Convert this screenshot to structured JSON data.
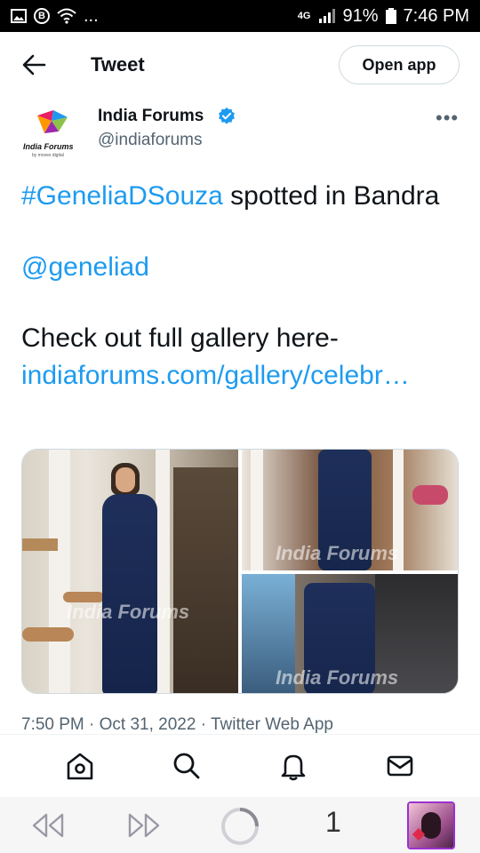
{
  "status_bar": {
    "network": "4G",
    "battery": "91%",
    "time": "7:46 PM",
    "overflow": "...",
    "notification_b": "B"
  },
  "header": {
    "title": "Tweet",
    "open_app_label": "Open app"
  },
  "author": {
    "name": "India Forums",
    "handle": "@indiaforums",
    "logo_text": "India Forums",
    "logo_subtext": "by moves digital",
    "more_label": "•••"
  },
  "tweet": {
    "hashtag": "#GeneliaDSouza",
    "line1_rest": " spotted in Bandra",
    "mention": "@geneliad",
    "line3": "Check out full gallery here-",
    "url": "indiaforums.com/gallery/celebr…",
    "timestamp": "7:50 PM · Oct 31, 2022 · Twitter Web App"
  },
  "media": {
    "watermark": "India Forums"
  },
  "bottom_nav": {
    "items": [
      "home-icon",
      "search-icon",
      "notifications-icon",
      "messages-icon"
    ]
  },
  "browser_bar": {
    "tab_count": "1"
  },
  "colors": {
    "link": "#1d9bf0",
    "text": "#0f1419",
    "secondary": "#536471",
    "verified": "#1d9bf0"
  }
}
